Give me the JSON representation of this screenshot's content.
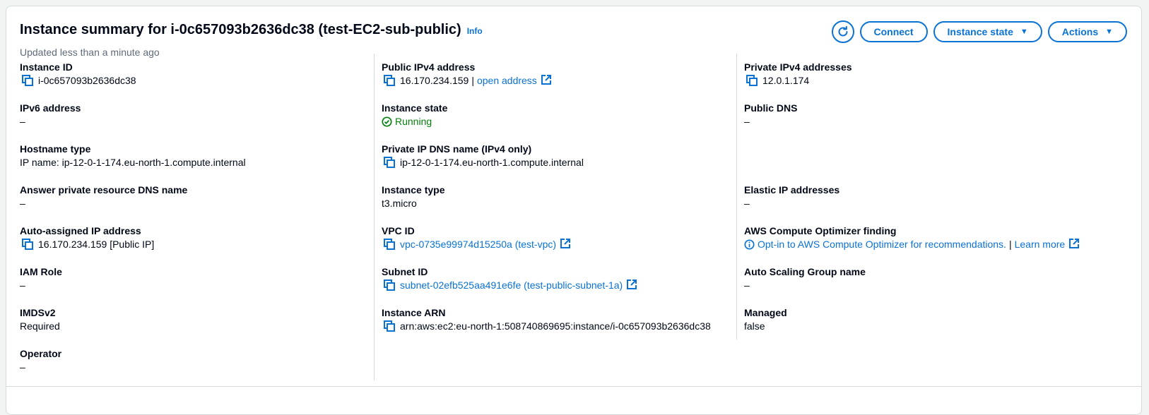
{
  "header": {
    "title": "Instance summary for i-0c657093b2636dc38 (test-EC2-sub-public)",
    "info": "Info",
    "updated": "Updated less than a minute ago"
  },
  "buttons": {
    "refresh_icon": "refresh-icon",
    "connect": "Connect",
    "instance_state": "Instance state",
    "actions": "Actions"
  },
  "col1": {
    "instance_id": {
      "label": "Instance ID",
      "value": "i-0c657093b2636dc38"
    },
    "ipv6": {
      "label": "IPv6 address",
      "value": "–"
    },
    "hostname_type": {
      "label": "Hostname type",
      "value": "IP name: ip-12-0-1-174.eu-north-1.compute.internal"
    },
    "answer_dns": {
      "label": "Answer private resource DNS name",
      "value": "–"
    },
    "auto_ip": {
      "label": "Auto-assigned IP address",
      "value": "16.170.234.159 [Public IP]"
    },
    "iam_role": {
      "label": "IAM Role",
      "value": "–"
    },
    "imdsv2": {
      "label": "IMDSv2",
      "value": "Required"
    },
    "operator": {
      "label": "Operator",
      "value": "–"
    }
  },
  "col2": {
    "public_ipv4": {
      "label": "Public IPv4 address",
      "value": "16.170.234.159",
      "sep": "|",
      "link": "open address"
    },
    "instance_state": {
      "label": "Instance state",
      "value": "Running"
    },
    "private_dns": {
      "label": "Private IP DNS name (IPv4 only)",
      "value": "ip-12-0-1-174.eu-north-1.compute.internal"
    },
    "instance_type": {
      "label": "Instance type",
      "value": "t3.micro"
    },
    "vpc_id": {
      "label": "VPC ID",
      "value": "vpc-0735e99974d15250a (test-vpc)"
    },
    "subnet_id": {
      "label": "Subnet ID",
      "value": "subnet-02efb525aa491e6fe (test-public-subnet-1a)"
    },
    "arn": {
      "label": "Instance ARN",
      "value": "arn:aws:ec2:eu-north-1:508740869695:instance/i-0c657093b2636dc38"
    }
  },
  "col3": {
    "private_ipv4": {
      "label": "Private IPv4 addresses",
      "value": "12.0.1.174"
    },
    "public_dns": {
      "label": "Public DNS",
      "value": "–"
    },
    "elastic_ip": {
      "label": "Elastic IP addresses",
      "value": "–"
    },
    "optimizer": {
      "label": "AWS Compute Optimizer finding",
      "link": "Opt-in to AWS Compute Optimizer for recommendations.",
      "sep": "|",
      "learn": "Learn more"
    },
    "asg": {
      "label": "Auto Scaling Group name",
      "value": "–"
    },
    "managed": {
      "label": "Managed",
      "value": "false"
    }
  },
  "colors": {
    "link": "#0972d3",
    "success": "#037f0c",
    "border": "#d5dbdb"
  }
}
